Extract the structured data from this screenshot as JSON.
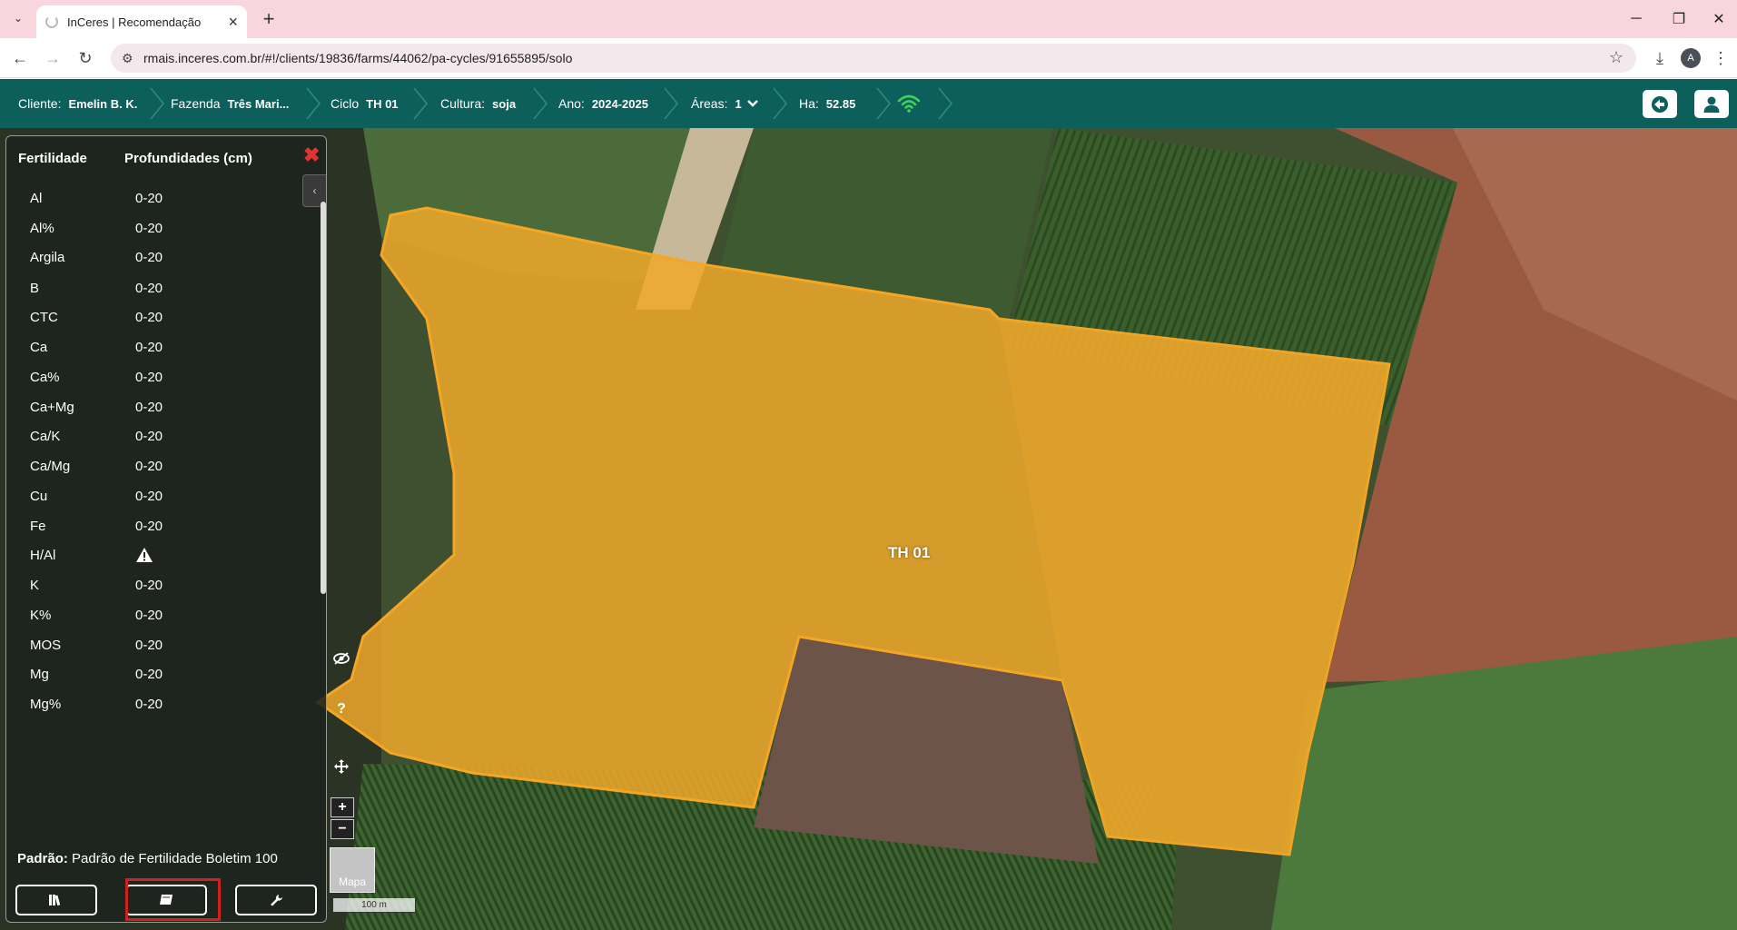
{
  "browser": {
    "tab_title": "InCeres | Recomendação",
    "url": "rmais.inceres.com.br/#!/clients/19836/farms/44062/pa-cycles/91655895/solo",
    "profile_initial": "A"
  },
  "header": {
    "client_label": "Cliente:",
    "client_value": "Emelin B. K.",
    "farm_label": "Fazenda",
    "farm_value": "Três Mari...",
    "cycle_label": "Ciclo",
    "cycle_value": "TH 01",
    "crop_label": "Cultura:",
    "crop_value": "soja",
    "year_label": "Ano:",
    "year_value": "2024-2025",
    "areas_label": "Áreas:",
    "areas_value": "1",
    "ha_label": "Ha:",
    "ha_value": "52.85",
    "color": "#0c5f5b"
  },
  "panel": {
    "col1": "Fertilidade",
    "col2": "Profundidades (cm)",
    "rows": [
      {
        "name": "Al",
        "depth": "0-20"
      },
      {
        "name": "Al%",
        "depth": "0-20"
      },
      {
        "name": "Argila",
        "depth": "0-20"
      },
      {
        "name": "B",
        "depth": "0-20"
      },
      {
        "name": "CTC",
        "depth": "0-20"
      },
      {
        "name": "Ca",
        "depth": "0-20"
      },
      {
        "name": "Ca%",
        "depth": "0-20"
      },
      {
        "name": "Ca+Mg",
        "depth": "0-20"
      },
      {
        "name": "Ca/K",
        "depth": "0-20"
      },
      {
        "name": "Ca/Mg",
        "depth": "0-20"
      },
      {
        "name": "Cu",
        "depth": "0-20"
      },
      {
        "name": "Fe",
        "depth": "0-20"
      },
      {
        "name": "H/Al",
        "depth": ""
      },
      {
        "name": "K",
        "depth": "0-20"
      },
      {
        "name": "K%",
        "depth": "0-20"
      },
      {
        "name": "MOS",
        "depth": "0-20"
      },
      {
        "name": "Mg",
        "depth": "0-20"
      },
      {
        "name": "Mg%",
        "depth": "0-20"
      }
    ],
    "padrao_label": "Padrão:",
    "padrao_value": "Padrão de Fertilidade Boletim 100"
  },
  "map": {
    "field_label": "TH 01",
    "layer_button": "Mapa",
    "scale": "100 m",
    "field_color": "#f0a82a"
  }
}
